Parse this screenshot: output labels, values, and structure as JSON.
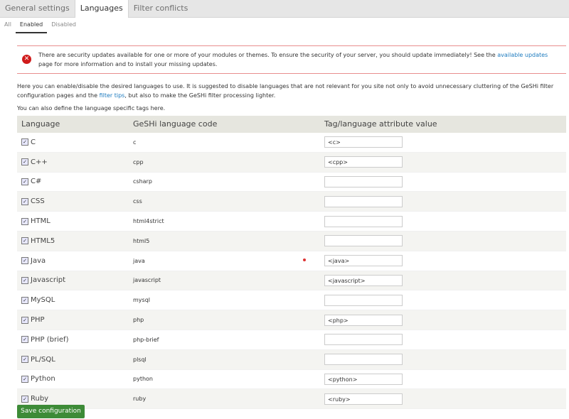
{
  "tabs": [
    "General settings",
    "Languages",
    "Filter conflicts"
  ],
  "subtabs": [
    "All",
    "Enabled",
    "Disabled"
  ],
  "alert": {
    "icon": "error-icon",
    "text_before": "There are security updates available for one or more of your modules or themes. To ensure the security of your server, you should update immediately! See the ",
    "link": "available updates",
    "text_after": " page for more information and to install your missing updates."
  },
  "intro": {
    "text_before": "Here you can enable/disable the desired languages to use. It is suggested to disable languages that are not relevant for you site not only to avoid unnecessary cluttering of the GeSHi filter configuration pages and the ",
    "link": "filter tips",
    "text_after": ", but also to make the GeSHi filter processing lighter."
  },
  "intro2": "You can also define the language specific tags here.",
  "table": {
    "headers": [
      "Language",
      "GeSHi language code",
      "Tag/language attribute value"
    ],
    "rows": [
      {
        "language": "C",
        "code": "c",
        "tag": "<c>"
      },
      {
        "language": "C++",
        "code": "cpp",
        "tag": "<cpp>"
      },
      {
        "language": "C#",
        "code": "csharp",
        "tag": ""
      },
      {
        "language": "CSS",
        "code": "css",
        "tag": ""
      },
      {
        "language": "HTML",
        "code": "html4strict",
        "tag": ""
      },
      {
        "language": "HTML5",
        "code": "html5",
        "tag": ""
      },
      {
        "language": "Java",
        "code": "java",
        "tag": "<java>"
      },
      {
        "language": "Javascript",
        "code": "javascript",
        "tag": "<javascript>"
      },
      {
        "language": "MySQL",
        "code": "mysql",
        "tag": ""
      },
      {
        "language": "PHP",
        "code": "php",
        "tag": "<php>"
      },
      {
        "language": "PHP (brief)",
        "code": "php-brief",
        "tag": ""
      },
      {
        "language": "PL/SQL",
        "code": "plsql",
        "tag": ""
      },
      {
        "language": "Python",
        "code": "python",
        "tag": "<python>"
      },
      {
        "language": "Ruby",
        "code": "ruby",
        "tag": "<ruby>"
      }
    ]
  },
  "save_label": "Save configuration",
  "colors": {
    "accent": "#1d7bbf",
    "save": "#3d8b37",
    "alert": "#d01b1b"
  }
}
